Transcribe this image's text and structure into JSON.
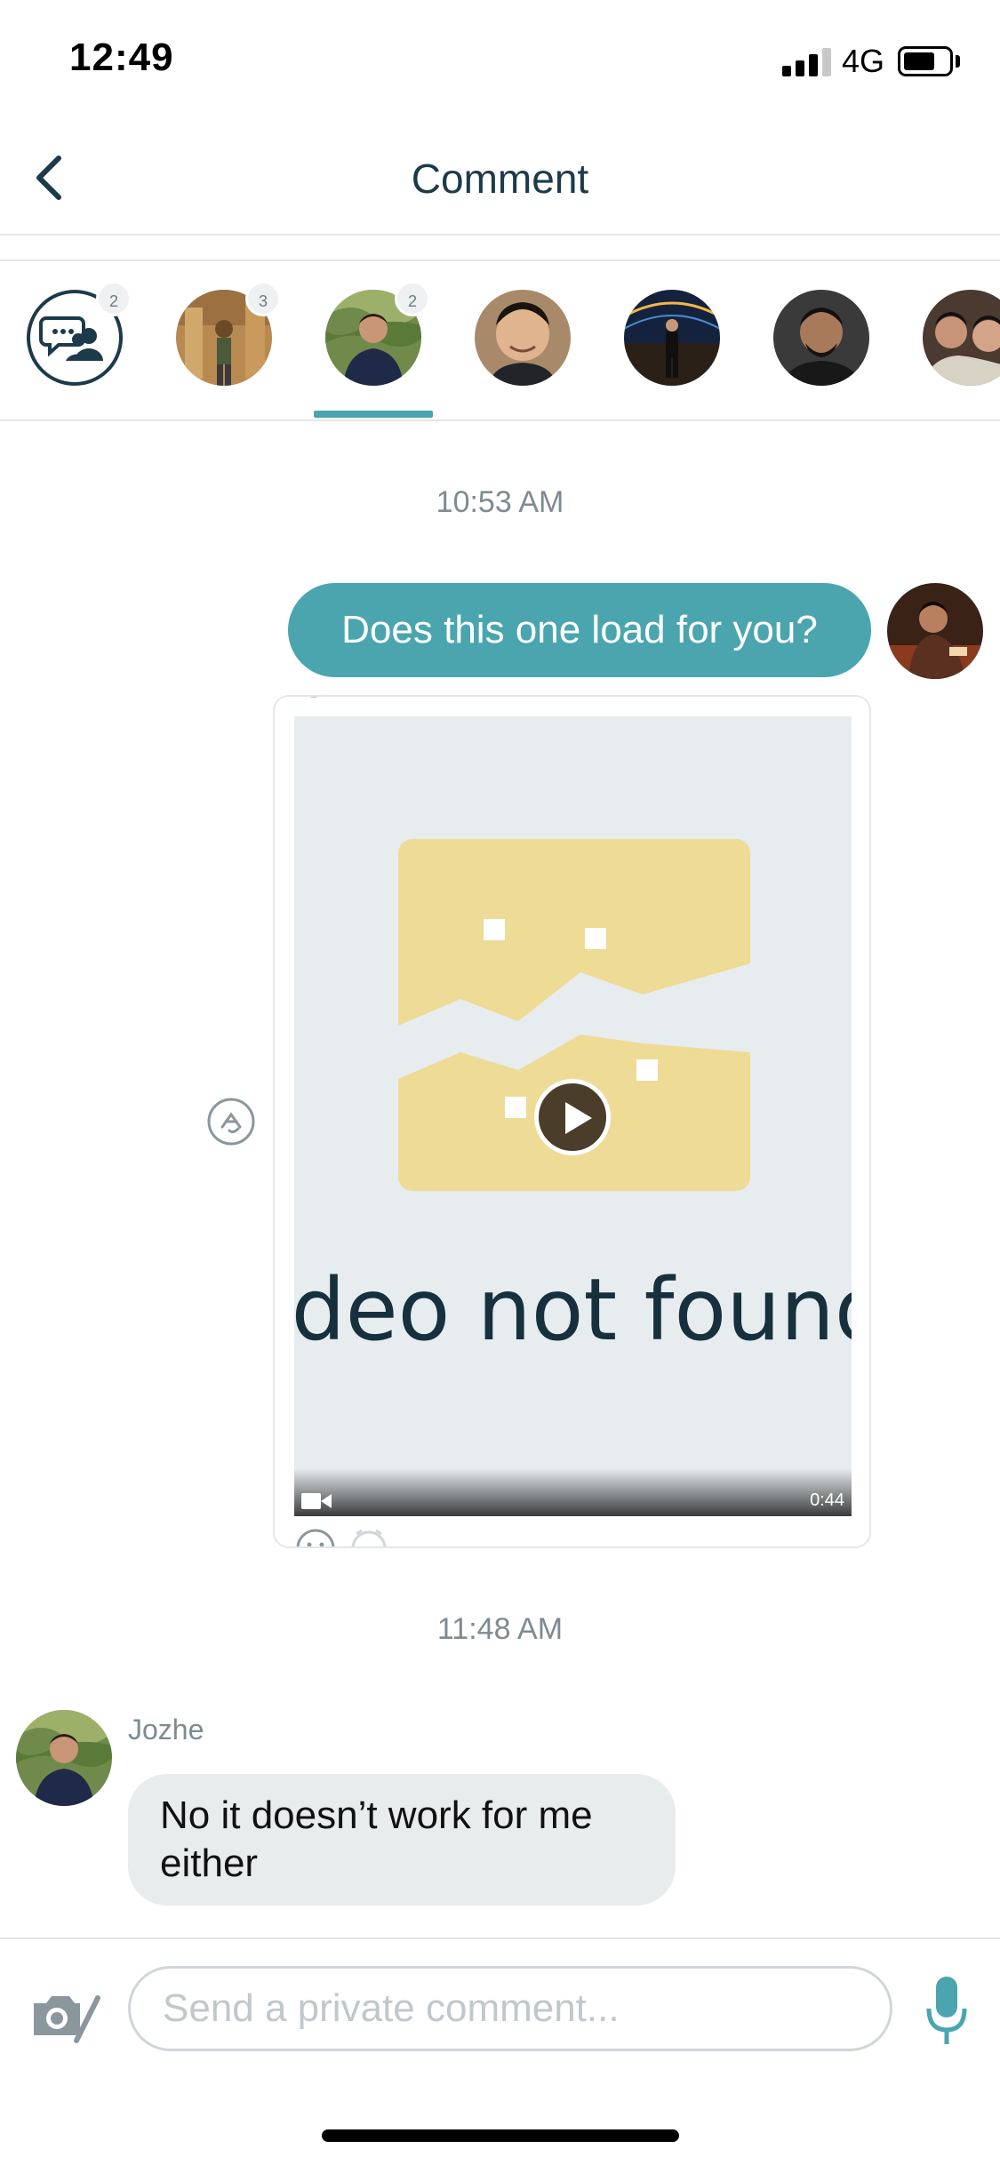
{
  "status_bar": {
    "time": "12:49",
    "network": "4G"
  },
  "header": {
    "title": "Comment"
  },
  "participants": [
    {
      "type": "group",
      "badge": "2"
    },
    {
      "type": "person",
      "badge": "3"
    },
    {
      "type": "person",
      "badge": "2",
      "selected": true
    },
    {
      "type": "person"
    },
    {
      "type": "person"
    },
    {
      "type": "person"
    },
    {
      "type": "person"
    }
  ],
  "messages": {
    "timestamp_1": "10:53 AM",
    "outgoing_text": "Does this one load for you?",
    "video_card": {
      "placeholder_text": "ideo not found",
      "duration": "0:44"
    },
    "timestamp_2": "11:48 AM",
    "incoming": {
      "sender": "Jozhe",
      "text": "No it doesn’t work for me either"
    }
  },
  "composer": {
    "placeholder": "Send a private comment..."
  },
  "colors": {
    "accent": "#4aa5ae",
    "title": "#1d3a4a",
    "incoming_bubble": "#e8eced"
  }
}
